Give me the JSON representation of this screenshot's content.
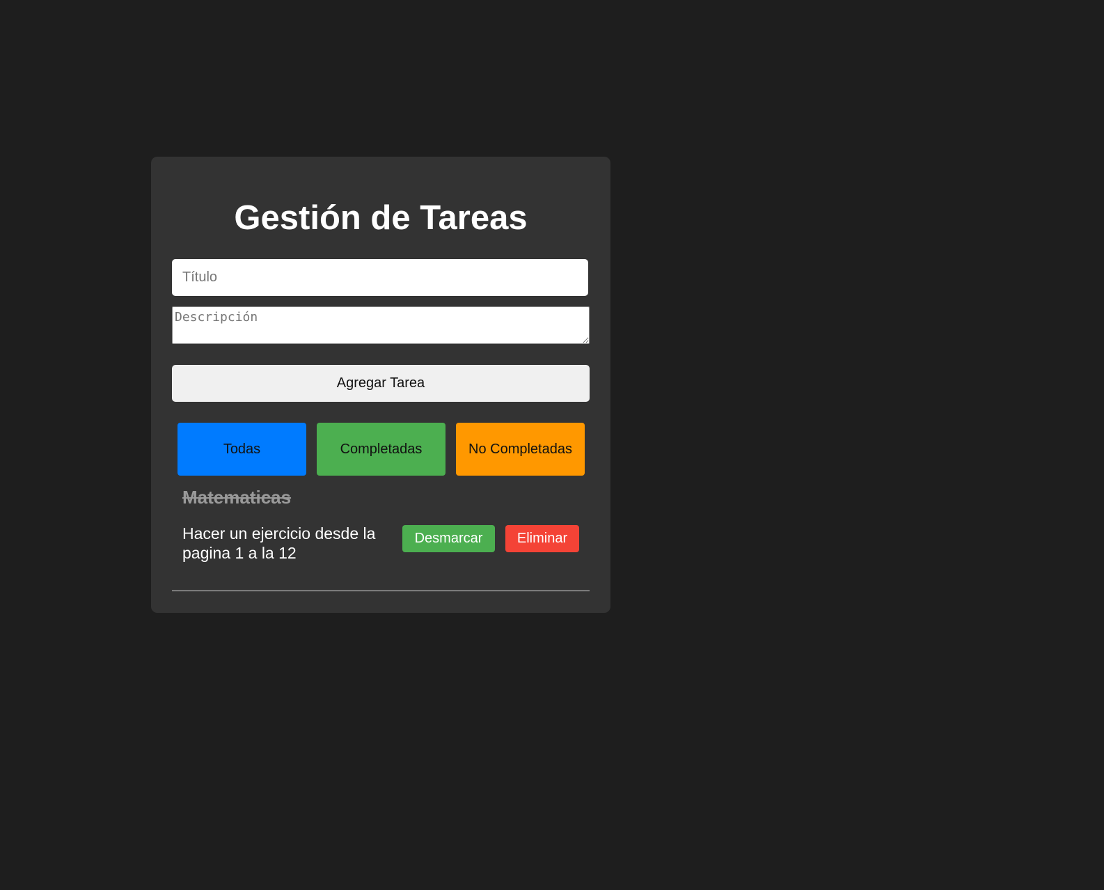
{
  "app": {
    "title": "Gestión de Tareas"
  },
  "form": {
    "title_placeholder": "Título",
    "title_value": "",
    "description_placeholder": "Descripción",
    "description_value": "",
    "add_label": "Agregar Tarea"
  },
  "filters": {
    "all_label": "Todas",
    "completed_label": "Completadas",
    "pending_label": "No Completadas"
  },
  "tasks": [
    {
      "title": "Matematicas",
      "description": "Hacer un ejercicio desde la pagina 1 a la 12",
      "completed": true,
      "unmark_label": "Desmarcar",
      "delete_label": "Eliminar"
    }
  ],
  "colors": {
    "page_background": "#1e1e1e",
    "card_background": "#333333",
    "filter_all": "#007bff",
    "filter_completed": "#4caf50",
    "filter_pending": "#ff9800",
    "unmark_button": "#4caf50",
    "delete_button": "#f44336"
  }
}
